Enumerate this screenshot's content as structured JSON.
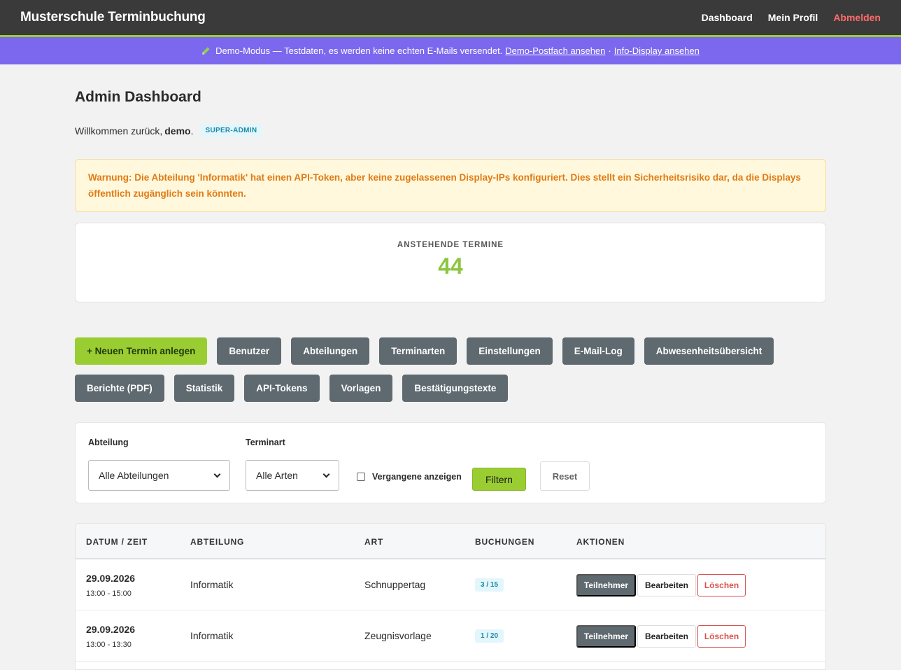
{
  "header": {
    "brand": "Musterschule Terminbuchung",
    "nav": {
      "dashboard": "Dashboard",
      "profile": "Mein Profil",
      "logout": "Abmelden"
    }
  },
  "demo_banner": {
    "text": "Demo-Modus — Testdaten, es werden keine echten E-Mails versendet.",
    "link_mailbox": "Demo-Postfach ansehen",
    "separator": "·",
    "link_display": "Info-Display ansehen"
  },
  "page": {
    "title": "Admin Dashboard",
    "welcome_prefix": "Willkommen zurück,",
    "username": "demo",
    "welcome_suffix": ".",
    "role_badge": "SUPER-ADMIN"
  },
  "warning": {
    "text": "Warnung: Die Abteilung 'Informatik' hat einen API-Token, aber keine zugelassenen Display-IPs konfiguriert. Dies stellt ein Sicherheitsrisiko dar, da die Displays öffentlich zugänglich sein könnten."
  },
  "stat": {
    "label": "ANSTEHENDE TERMINE",
    "value": "44"
  },
  "actions": {
    "new_appointment": "+ Neuen Termin anlegen",
    "users": "Benutzer",
    "departments": "Abteilungen",
    "types": "Terminarten",
    "settings": "Einstellungen",
    "email_log": "E-Mail-Log",
    "absence": "Abwesenheitsübersicht",
    "reports": "Berichte (PDF)",
    "statistics": "Statistik",
    "api_tokens": "API-Tokens",
    "templates": "Vorlagen",
    "confirmation_texts": "Bestätigungstexte"
  },
  "filter": {
    "department_label": "Abteilung",
    "department_value": "Alle Abteilungen",
    "type_label": "Terminart",
    "type_value": "Alle Arten",
    "past_label": "Vergangene anzeigen",
    "filter_button": "Filtern",
    "reset_button": "Reset"
  },
  "table": {
    "headers": {
      "date": "DATUM / ZEIT",
      "department": "ABTEILUNG",
      "type": "ART",
      "bookings": "BUCHUNGEN",
      "actions": "AKTIONEN"
    },
    "rows": [
      {
        "date": "29.09.2026",
        "time": "13:00 - 15:00",
        "department": "Informatik",
        "type": "Schnuppertag",
        "bookings": "3 / 15",
        "btn_participants": "Teilnehmer",
        "btn_edit": "Bearbeiten",
        "btn_delete": "Löschen"
      },
      {
        "date": "29.09.2026",
        "time": "13:00 - 13:30",
        "department": "Informatik",
        "type": "Zeugnisvorlage",
        "bookings": "1 / 20",
        "btn_participants": "Teilnehmer",
        "btn_edit": "Bearbeiten",
        "btn_delete": "Löschen"
      }
    ]
  },
  "colors": {
    "accent_green": "#9acd32",
    "banner_purple": "#7b68ee",
    "topbar": "#3a3a3a",
    "warning_text": "#e07b16",
    "danger": "#d9534f"
  }
}
